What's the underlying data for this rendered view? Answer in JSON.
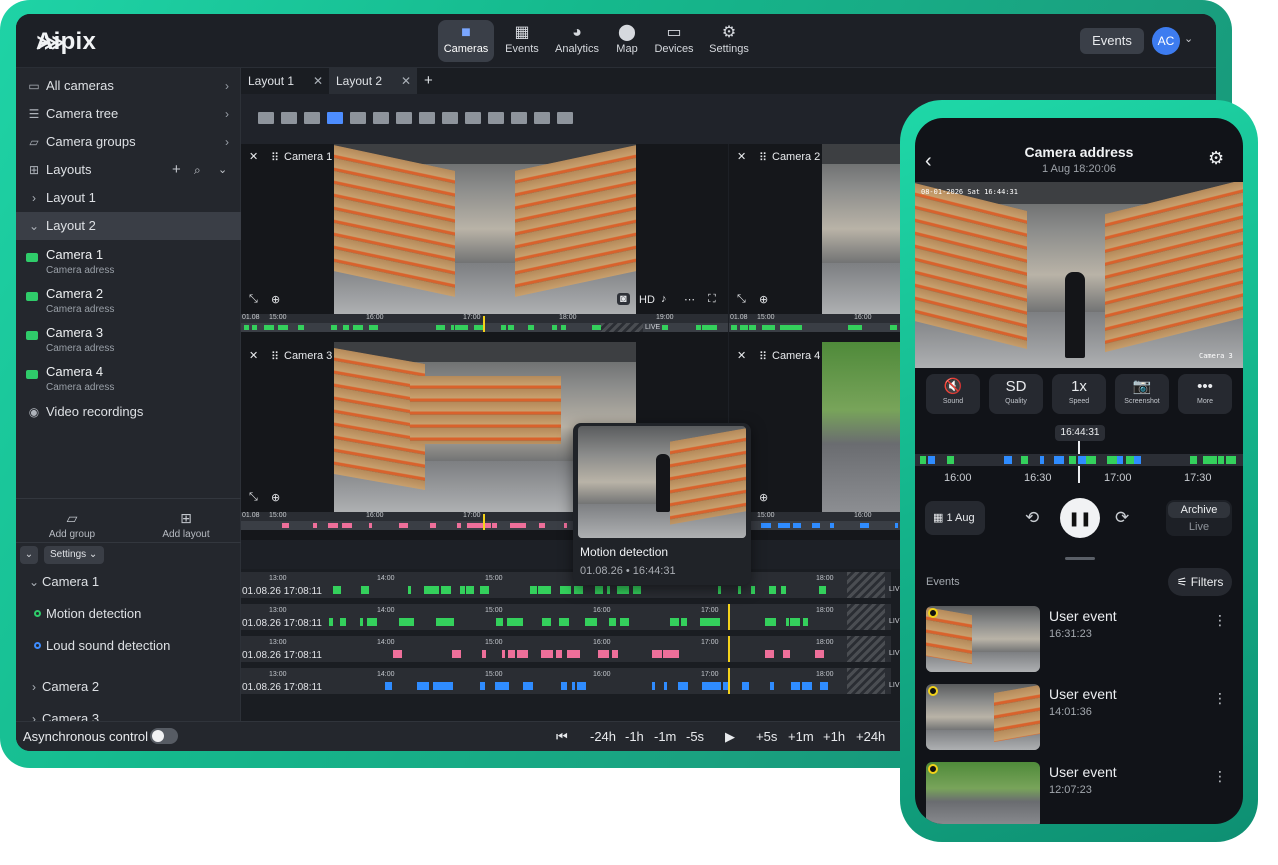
{
  "brand": "Aipix",
  "nav": [
    {
      "label": "Cameras",
      "icon": "camera-icon"
    },
    {
      "label": "Events",
      "icon": "calendar-icon"
    },
    {
      "label": "Analytics",
      "icon": "pie-chart-icon"
    },
    {
      "label": "Map",
      "icon": "map-pin-icon"
    },
    {
      "label": "Devices",
      "icon": "monitor-icon"
    },
    {
      "label": "Settings",
      "icon": "gear-icon"
    }
  ],
  "header": {
    "events_button": "Events",
    "avatar": "AC"
  },
  "sidebar": {
    "items": [
      "All cameras",
      "Camera tree",
      "Camera groups",
      "Layouts"
    ],
    "layouts": [
      "Layout 1",
      "Layout 2"
    ],
    "cameras": [
      {
        "name": "Camera 1",
        "address": "Camera adress"
      },
      {
        "name": "Camera 2",
        "address": "Camera adress"
      },
      {
        "name": "Camera 3",
        "address": "Camera adress"
      },
      {
        "name": "Camera 4",
        "address": "Camera adress"
      }
    ],
    "video_recordings": "Video recordings",
    "add_group": "Add group",
    "add_layout": "Add layout",
    "settings": "Settings",
    "tree_camera1": "Camera 1",
    "motion": "Motion detection",
    "loud": "Loud sound detection",
    "tree_camera2": "Camera 2",
    "tree_camera3": "Camera 3"
  },
  "tabs": [
    "Layout 1",
    "Layout 2"
  ],
  "tiles": {
    "cam1": "Camera 1",
    "cam2": "Camera 2",
    "cam3": "Camera 3",
    "cam4": "Camera 4",
    "hd": "HD",
    "ticks_top": [
      "01.08",
      "15:00",
      "16:00",
      "17:00",
      "18:00",
      "19:00"
    ],
    "ticks_right": [
      "01.08",
      "15:00",
      "16:00"
    ],
    "live": "LIVE"
  },
  "tooltip": {
    "title": "Motion detection",
    "time": "01.08.26 • 16:44:31"
  },
  "timelines": {
    "stamp": "01.08.26 17:08:11",
    "row1_ticks": [
      "13:00",
      "14:00",
      "15:00",
      "16:00",
      "17:00",
      "18:00"
    ],
    "live": "LIV"
  },
  "controls": {
    "async": "Asynchronous control",
    "back": [
      "-24h",
      "-1h",
      "-1m",
      "-5s"
    ],
    "fwd": [
      "+5s",
      "+1m",
      "+1h",
      "+24h"
    ]
  },
  "mobile": {
    "title": "Camera address",
    "subtitle": "1 Aug 18:20:06",
    "osd_top": "08-01-2026 Sat 16:44:31",
    "osd_cam": "Camera 3",
    "buttons": [
      {
        "big": "🔇",
        "small": "Sound"
      },
      {
        "big": "SD",
        "small": "Quality"
      },
      {
        "big": "1x",
        "small": "Speed"
      },
      {
        "big": "📷",
        "small": "Screenshot"
      },
      {
        "big": "•••",
        "small": "More"
      }
    ],
    "playhead": "16:44:31",
    "ticks": [
      "16:00",
      "16:30",
      "17:00",
      "17:30"
    ],
    "date_btn": "1 Aug",
    "archive": "Archive",
    "live": "Live",
    "events_label": "Events",
    "filters": "Filters",
    "events": [
      {
        "title": "User event",
        "time": "16:31:23"
      },
      {
        "title": "User event",
        "time": "14:01:36"
      },
      {
        "title": "User event",
        "time": "12:07:23"
      }
    ]
  }
}
